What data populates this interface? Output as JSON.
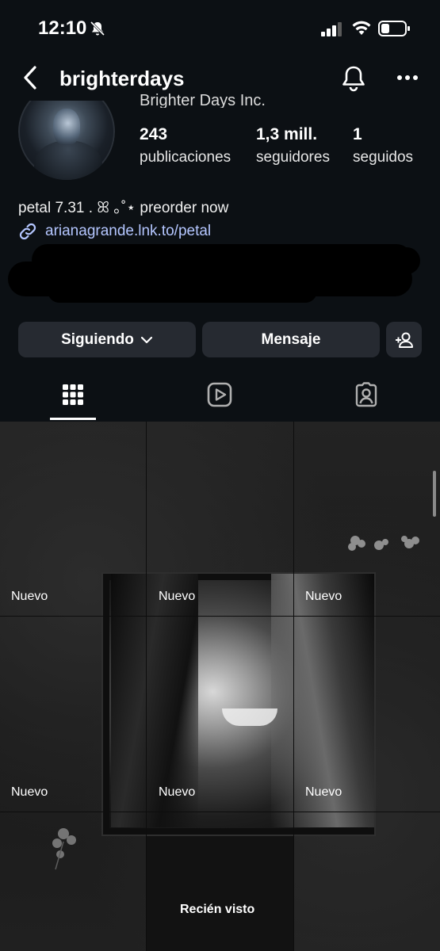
{
  "status_bar": {
    "time": "12:10"
  },
  "header": {
    "username": "brighterdays"
  },
  "profile": {
    "display_name": "Brighter Days Inc.",
    "stats": [
      {
        "value": "243",
        "label": "publicaciones"
      },
      {
        "value": "1,3 mill.",
        "label": "seguidores"
      },
      {
        "value": "1",
        "label": "seguidos"
      }
    ],
    "bio": "petal 7.31 . ꕤ ｡˚⋆ preorder now",
    "link": "arianagrande.lnk.to/petal"
  },
  "actions": {
    "following": "Siguiendo",
    "message": "Mensaje"
  },
  "grid": {
    "tiles": [
      {
        "badge": "Nuevo"
      },
      {
        "badge": "Nuevo"
      },
      {
        "badge": "Nuevo"
      },
      {
        "badge": "Nuevo"
      },
      {
        "badge": "Nuevo"
      },
      {
        "badge": "Nuevo"
      }
    ],
    "recent_label": "Recién visto"
  },
  "colors": {
    "background": "#0c1014",
    "button": "#262a31",
    "link": "#b4c6ff"
  }
}
